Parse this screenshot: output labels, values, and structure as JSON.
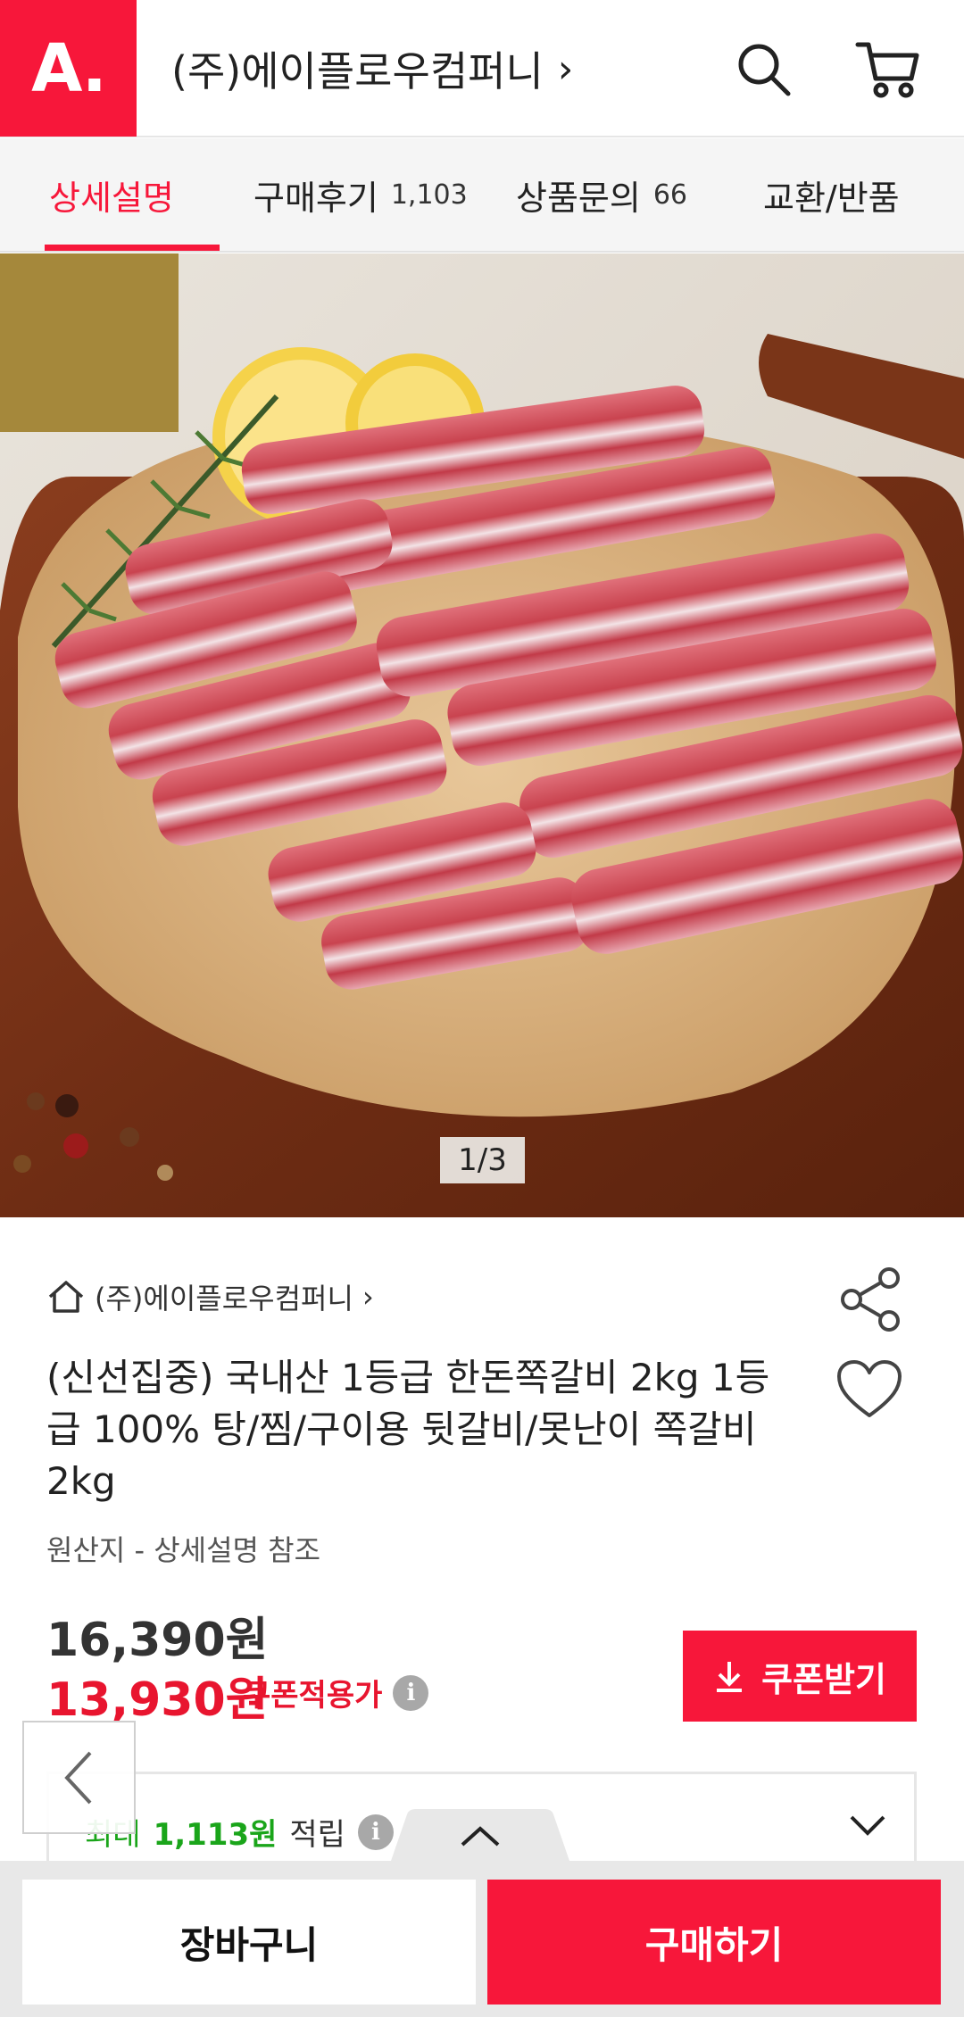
{
  "header": {
    "logo_text": "A.",
    "store_name": "(주)에이플로우컴퍼니",
    "store_chevron": "›",
    "search_icon": "search-icon",
    "cart_icon": "cart-icon"
  },
  "tabs": [
    {
      "label": "상세설명",
      "count": "",
      "active": true
    },
    {
      "label": "구매후기",
      "count": "1,103",
      "active": false
    },
    {
      "label": "상품문의",
      "count": "66",
      "active": false
    },
    {
      "label": "교환/반품",
      "count": "",
      "active": false
    }
  ],
  "gallery": {
    "counter": "1/3"
  },
  "product": {
    "shop_link": "(주)에이플로우컴퍼니",
    "shop_chevron": "›",
    "title": "(신선집중) 국내산 1등급 한돈쪽갈비 2kg 1등급 100% 탕/찜/구이용 뒷갈비/못난이 쪽갈비 2kg",
    "origin": "원산지 - 상세설명 참조",
    "price_original": "16,390원",
    "price_sale": "13,930원",
    "coupon_label": "쿠폰적용가",
    "coupon_button": "쿠폰받기",
    "info_glyph": "i"
  },
  "points": {
    "prefix": "최대",
    "amount": "1,113원",
    "suffix": "적립"
  },
  "bottom": {
    "cart_label": "장바구니",
    "buy_label": "구매하기"
  },
  "colors": {
    "brand": "#f7173a",
    "sale": "#e8152f",
    "points": "#1aa51a"
  }
}
